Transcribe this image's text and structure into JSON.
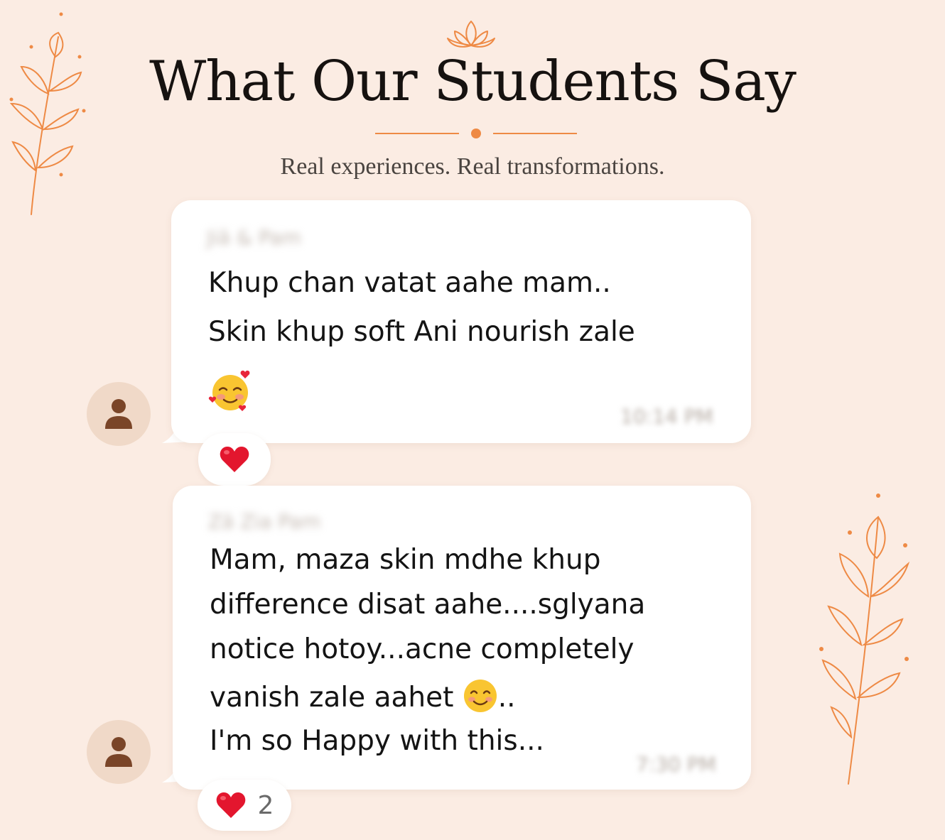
{
  "header": {
    "title": "What Our Students Say",
    "subtitle": "Real experiences. Real transformations."
  },
  "colors": {
    "background": "#fbece3",
    "accent": "#ee8a45",
    "avatar_bg": "#f0d9c8",
    "avatar_icon": "#7a4528"
  },
  "testimonials": [
    {
      "sender": "Jiā & Pam",
      "lines": [
        "Khup chan vatat aahe mam..",
        "Skin khup soft Ani nourish zale"
      ],
      "emoji": "smiling-face-with-hearts",
      "time": "10:14 PM",
      "reaction": {
        "icon": "heart",
        "count": ""
      }
    },
    {
      "sender": "Zā Zia Pam",
      "lines": [
        "Mam, maza skin mdhe khup",
        "difference disat aahe....sglyana",
        "notice hotoy...acne completely",
        "vanish zale aahet",
        "I'm so Happy with this..."
      ],
      "line4_suffix": "..",
      "emoji": "smiling-face",
      "time": "7:30 PM",
      "reaction": {
        "icon": "heart",
        "count": "2"
      }
    }
  ]
}
